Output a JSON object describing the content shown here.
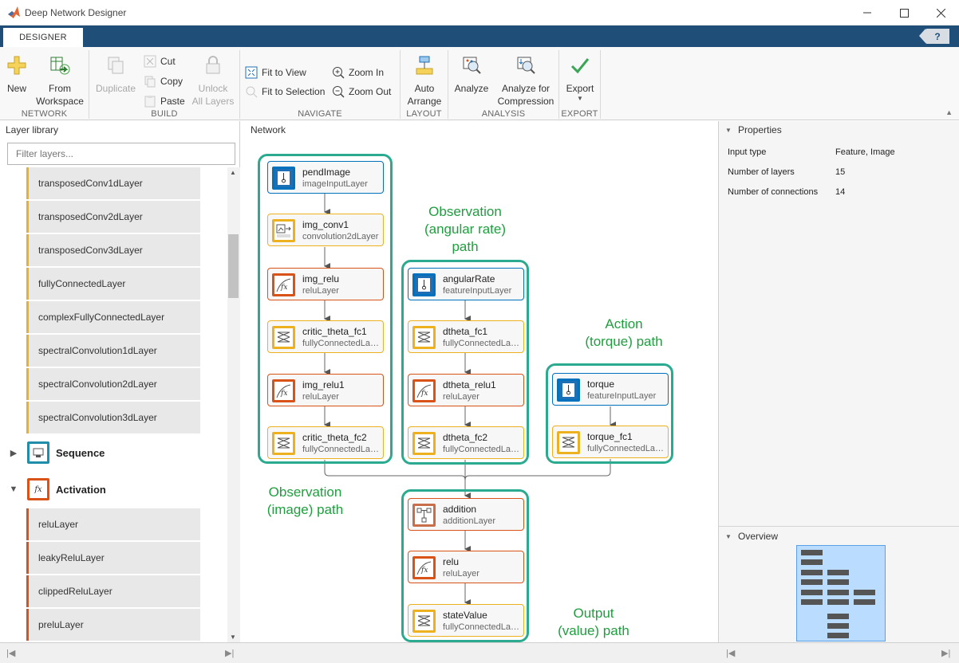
{
  "window": {
    "title": "Deep Network Designer"
  },
  "tabs": [
    {
      "label": "DESIGNER"
    }
  ],
  "help": "?",
  "ribbon": {
    "network": {
      "label": "NETWORK",
      "new": "New",
      "from_ws_1": "From",
      "from_ws_2": "Workspace"
    },
    "build": {
      "label": "BUILD",
      "duplicate": "Duplicate",
      "cut": "Cut",
      "copy": "Copy",
      "paste": "Paste",
      "unlock_1": "Unlock",
      "unlock_2": "All Layers"
    },
    "navigate": {
      "label": "NAVIGATE",
      "fit_view": "Fit to View",
      "fit_sel": "Fit to Selection",
      "zoom_in": "Zoom In",
      "zoom_out": "Zoom Out"
    },
    "layout": {
      "label": "LAYOUT",
      "auto_1": "Auto",
      "auto_2": "Arrange"
    },
    "analysis": {
      "label": "ANALYSIS",
      "analyze": "Analyze",
      "afc_1": "Analyze for",
      "afc_2": "Compression"
    },
    "export": {
      "label": "EXPORT",
      "export": "Export"
    }
  },
  "library": {
    "title": "Layer library",
    "filter_placeholder": "Filter layers...",
    "conv_items": [
      "transposedConv1dLayer",
      "transposedConv2dLayer",
      "transposedConv3dLayer",
      "fullyConnectedLayer",
      "complexFullyConnectedLayer",
      "spectralConvolution1dLayer",
      "spectralConvolution2dLayer",
      "spectralConvolution3dLayer"
    ],
    "categories": [
      {
        "name": "Sequence",
        "color": "#1f8ea8"
      },
      {
        "name": "Activation",
        "color": "#d95319"
      }
    ],
    "activation_items": [
      "reluLayer",
      "leakyReluLayer",
      "clippedReluLayer",
      "preluLayer"
    ]
  },
  "network": {
    "title": "Network",
    "groups": {
      "image": [
        "Observation",
        "(image) path"
      ],
      "rate": [
        "Observation",
        "(angular rate)",
        "path"
      ],
      "action": [
        "Action",
        "(torque) path"
      ],
      "output": [
        "Output",
        "(value) path"
      ]
    },
    "nodes": {
      "pendImage": {
        "name": "pendImage",
        "type": "imageInputLayer"
      },
      "img_conv1": {
        "name": "img_conv1",
        "type": "convolution2dLayer"
      },
      "img_relu": {
        "name": "img_relu",
        "type": "reluLayer"
      },
      "critic_theta_fc1": {
        "name": "critic_theta_fc1",
        "type": "fullyConnectedLayer"
      },
      "img_relu1": {
        "name": "img_relu1",
        "type": "reluLayer"
      },
      "critic_theta_fc2": {
        "name": "critic_theta_fc2",
        "type": "fullyConnectedLayer"
      },
      "angularRate": {
        "name": "angularRate",
        "type": "featureInputLayer"
      },
      "dtheta_fc1": {
        "name": "dtheta_fc1",
        "type": "fullyConnectedLayer"
      },
      "dtheta_relu1": {
        "name": "dtheta_relu1",
        "type": "reluLayer"
      },
      "dtheta_fc2": {
        "name": "dtheta_fc2",
        "type": "fullyConnectedLayer"
      },
      "torque": {
        "name": "torque",
        "type": "featureInputLayer"
      },
      "torque_fc1": {
        "name": "torque_fc1",
        "type": "fullyConnectedLayer"
      },
      "addition": {
        "name": "addition",
        "type": "additionLayer"
      },
      "relu": {
        "name": "relu",
        "type": "reluLayer"
      },
      "stateValue": {
        "name": "stateValue",
        "type": "fullyConnectedLayer"
      }
    }
  },
  "properties": {
    "title": "Properties",
    "rows": [
      {
        "key": "Input type",
        "value": "Feature, Image"
      },
      {
        "key": "Number of layers",
        "value": "15"
      },
      {
        "key": "Number of connections",
        "value": "14"
      }
    ]
  },
  "overview": {
    "title": "Overview"
  },
  "colors": {
    "accent": "#1f4e79",
    "group": "#2aab8f",
    "label_green": "#1e9e3e",
    "input": "#0072bd",
    "fc": "#edb120",
    "activation": "#d95319"
  }
}
